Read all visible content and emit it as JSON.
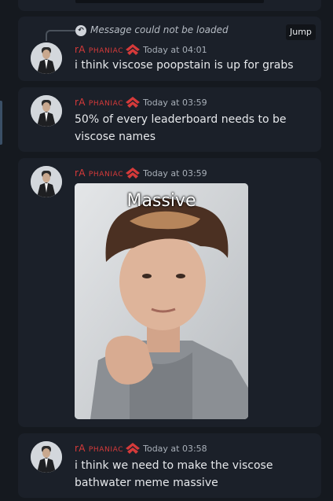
{
  "reply": {
    "text": "Message could not be loaded",
    "jump_label": "Jump"
  },
  "messages": [
    {
      "username_first": "rA",
      "username_rest": "PHANIAC",
      "timestamp": "Today at 04:01",
      "text": "i think viscose poopstain is up for grabs"
    },
    {
      "username_first": "rA",
      "username_rest": "PHANIAC",
      "timestamp": "Today at 03:59",
      "text": "50% of every leaderboard needs to be viscose names"
    },
    {
      "username_first": "rA",
      "username_rest": "PHANIAC",
      "timestamp": "Today at 03:59",
      "image_caption": "Massive"
    },
    {
      "username_first": "rA",
      "username_rest": "PHANIAC",
      "timestamp": "Today at 03:58",
      "text": "i think we need to make the viscose bathwater meme massive"
    }
  ],
  "colors": {
    "username": "#d63a3a",
    "background": "#15191f",
    "card": "#1b2029"
  },
  "icons": {
    "reply": "reply-arrow-icon",
    "badge": "red-chevron-badge-icon"
  }
}
